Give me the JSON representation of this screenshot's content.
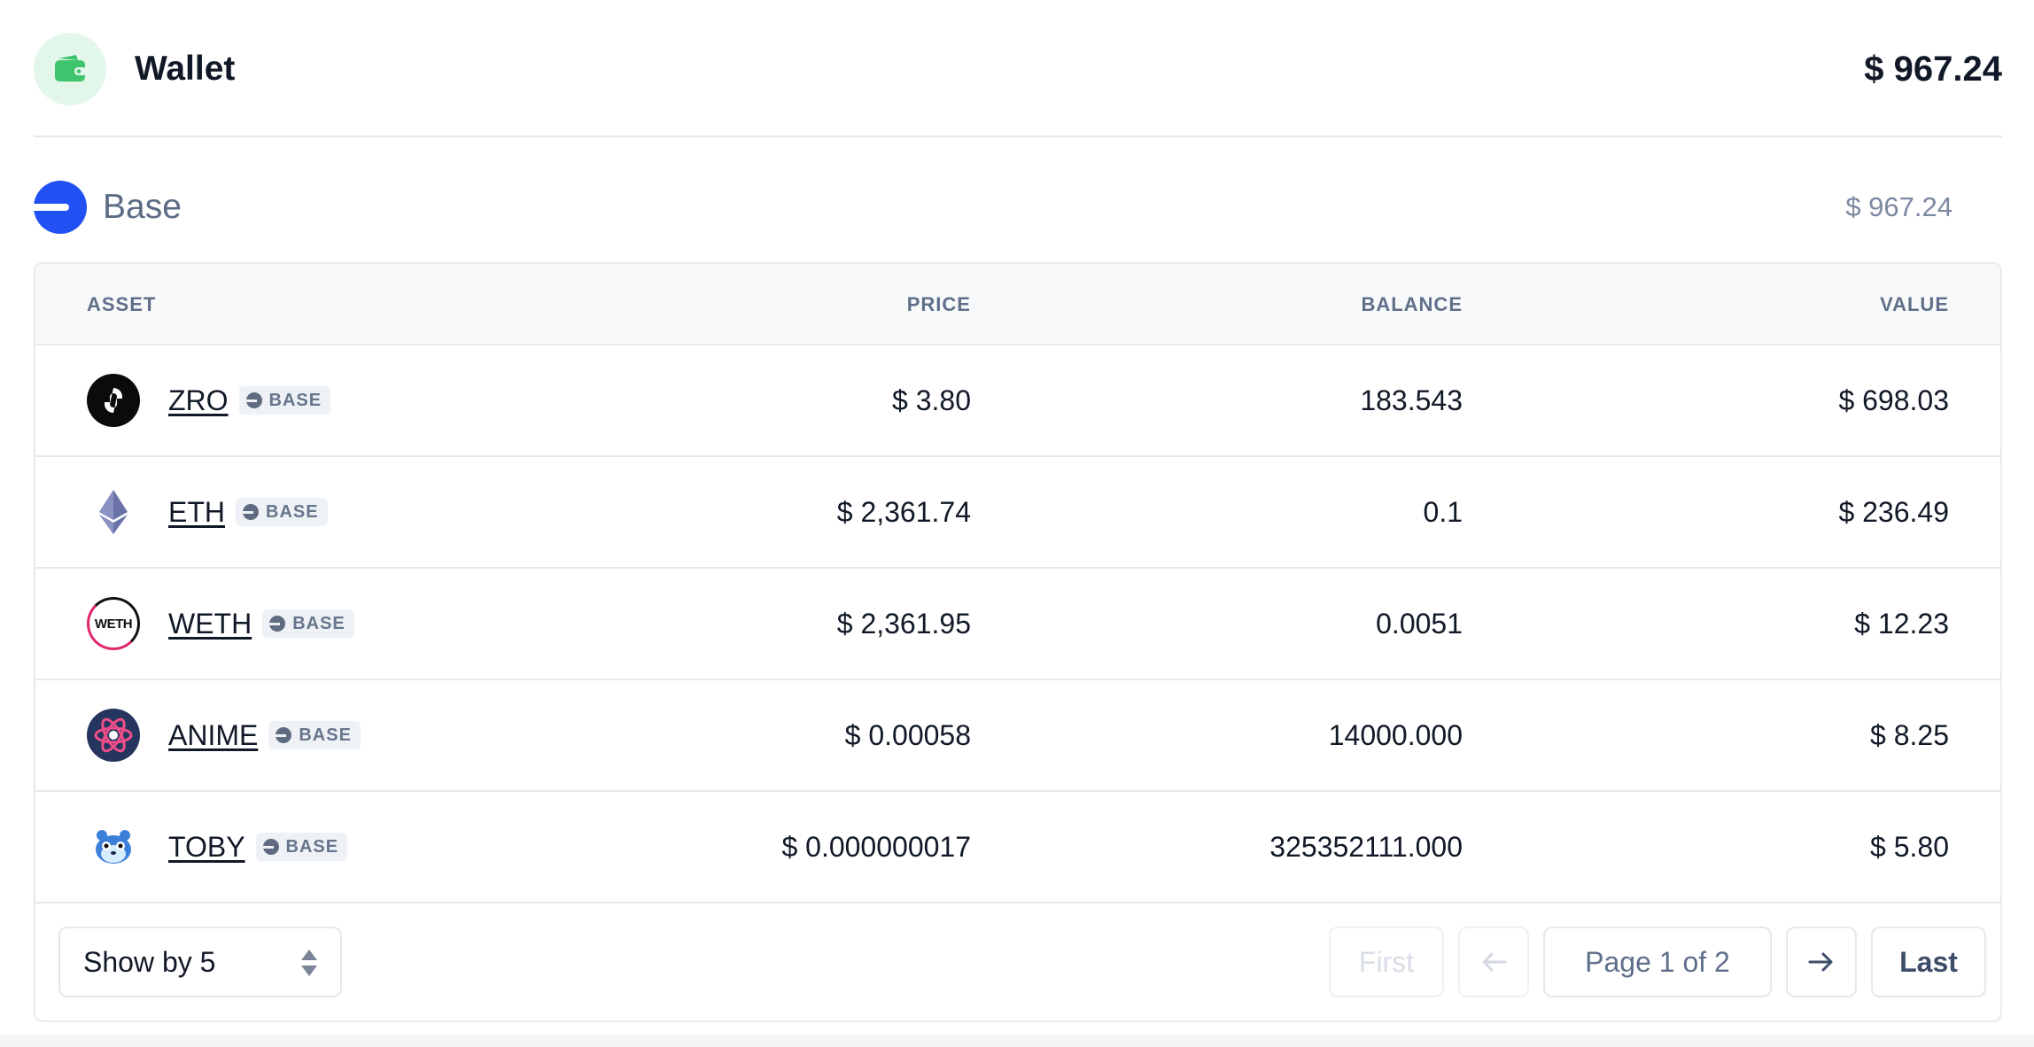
{
  "wallet": {
    "title": "Wallet",
    "total": "$ 967.24",
    "icon": "wallet-icon",
    "accent": "#34c268"
  },
  "network": {
    "name": "Base",
    "total": "$ 967.24",
    "icon": "base-network-icon",
    "color": "#2151f5"
  },
  "table": {
    "headers": {
      "asset": "ASSET",
      "price": "PRICE",
      "balance": "BALANCE",
      "value": "VALUE"
    },
    "rows": [
      {
        "symbol": "ZRO",
        "chain": "BASE",
        "price": "$ 3.80",
        "balance": "183.543",
        "value": "$ 698.03",
        "icon": "zro-token-icon"
      },
      {
        "symbol": "ETH",
        "chain": "BASE",
        "price": "$ 2,361.74",
        "balance": "0.1",
        "value": "$ 236.49",
        "icon": "eth-token-icon"
      },
      {
        "symbol": "WETH",
        "chain": "BASE",
        "price": "$ 2,361.95",
        "balance": "0.0051",
        "value": "$ 12.23",
        "icon": "weth-token-icon",
        "logo_text": "WETH"
      },
      {
        "symbol": "ANIME",
        "chain": "BASE",
        "price": "$ 0.00058",
        "balance": "14000.000",
        "value": "$ 8.25",
        "icon": "anime-token-icon"
      },
      {
        "symbol": "TOBY",
        "chain": "BASE",
        "price": "$ 0.000000017",
        "balance": "325352111.000",
        "value": "$ 5.80",
        "icon": "toby-token-icon"
      }
    ]
  },
  "pagination": {
    "page_size_label": "Show by 5",
    "first": "First",
    "prev_icon": "arrow-left-icon",
    "page_label": "Page 1 of 2",
    "next_icon": "arrow-right-icon",
    "last": "Last"
  }
}
